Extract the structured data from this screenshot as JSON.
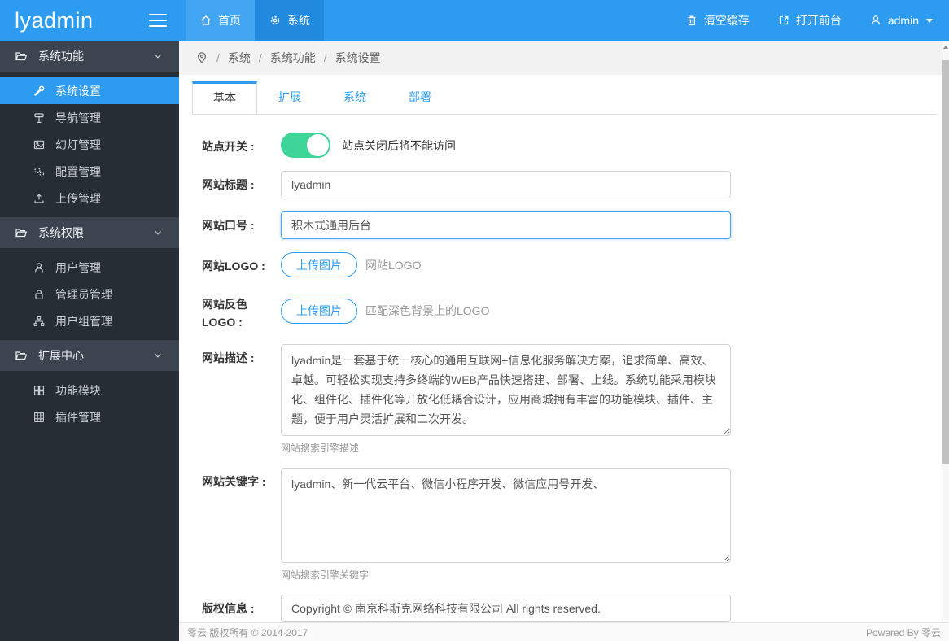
{
  "header": {
    "logo": "lyadmin",
    "nav": [
      {
        "label": "首页",
        "icon": "home-icon"
      },
      {
        "label": "系统",
        "icon": "gear-icon",
        "active": true
      }
    ],
    "actions": [
      {
        "label": "清空缓存",
        "icon": "trash-icon"
      },
      {
        "label": "打开前台",
        "icon": "external-link-icon"
      },
      {
        "label": "admin",
        "icon": "user-icon"
      }
    ]
  },
  "sidebar": {
    "sections": [
      {
        "label": "系统功能",
        "items": [
          {
            "label": "系统设置",
            "icon": "wrench-icon",
            "active": true
          },
          {
            "label": "导航管理",
            "icon": "signpost-icon"
          },
          {
            "label": "幻灯管理",
            "icon": "image-icon"
          },
          {
            "label": "配置管理",
            "icon": "cogs-icon"
          },
          {
            "label": "上传管理",
            "icon": "upload-icon"
          }
        ]
      },
      {
        "label": "系统权限",
        "items": [
          {
            "label": "用户管理",
            "icon": "user-icon"
          },
          {
            "label": "管理员管理",
            "icon": "lock-icon"
          },
          {
            "label": "用户组管理",
            "icon": "sitemap-icon"
          }
        ]
      },
      {
        "label": "扩展中心",
        "items": [
          {
            "label": "功能模块",
            "icon": "modules-icon"
          },
          {
            "label": "插件管理",
            "icon": "plugins-icon"
          }
        ]
      }
    ]
  },
  "breadcrumb": {
    "separator": "/",
    "items": [
      "系统",
      "系统功能",
      "系统设置"
    ]
  },
  "tabs": [
    {
      "label": "基本",
      "active": true
    },
    {
      "label": "扩展"
    },
    {
      "label": "系统"
    },
    {
      "label": "部署"
    }
  ],
  "form": {
    "fields": [
      {
        "label": "站点开关 :",
        "type": "toggle",
        "on": true,
        "hint": "站点关闭后将不能访问"
      },
      {
        "label": "网站标题 :",
        "type": "input",
        "value": "lyadmin"
      },
      {
        "label": "网站口号 :",
        "type": "input",
        "value": "积木式通用后台",
        "focused": true
      },
      {
        "label": "网站LOGO :",
        "type": "upload",
        "button_label": "上传图片",
        "hint": "网站LOGO"
      },
      {
        "label": "网站反色LOGO :",
        "type": "upload",
        "button_label": "上传图片",
        "hint": "匹配深色背景上的LOGO"
      },
      {
        "label": "网站描述 :",
        "type": "textarea",
        "value": "lyadmin是一套基于统一核心的通用互联网+信息化服务解决方案，追求简单、高效、卓越。可轻松实现支持多终端的WEB产品快速搭建、部署、上线。系统功能采用模块化、组件化、插件化等开放化低耦合设计，应用商城拥有丰富的功能模块、插件、主题，便于用户灵活扩展和二次开发。",
        "hint": "网站搜索引擎描述"
      },
      {
        "label": "网站关键字 :",
        "type": "textarea",
        "value": "lyadmin、新一代云平台、微信小程序开发、微信应用号开发、",
        "hint": "网站搜索引擎关键字"
      },
      {
        "label": "版权信息 :",
        "type": "input",
        "value": "Copyright © 南京科斯克网络科技有限公司 All rights reserved."
      }
    ]
  },
  "footer": {
    "left": "零云 版权所有 © 2014-2017",
    "right": "Powered By 零云"
  },
  "colors": {
    "header_blue": "#2D9CF0",
    "nav_active_blue": "#2189DE",
    "nav_hover_blue": "#43A6F3",
    "sidebar_dark": "#272D35",
    "sidebar_section": "#3C4450",
    "accent": "#2D9CF0",
    "toggle_green": "#3DD598",
    "breadcrumb_bg": "#F2F2F2",
    "input_border": "#D2D2D2",
    "hint_gray": "#999999"
  }
}
